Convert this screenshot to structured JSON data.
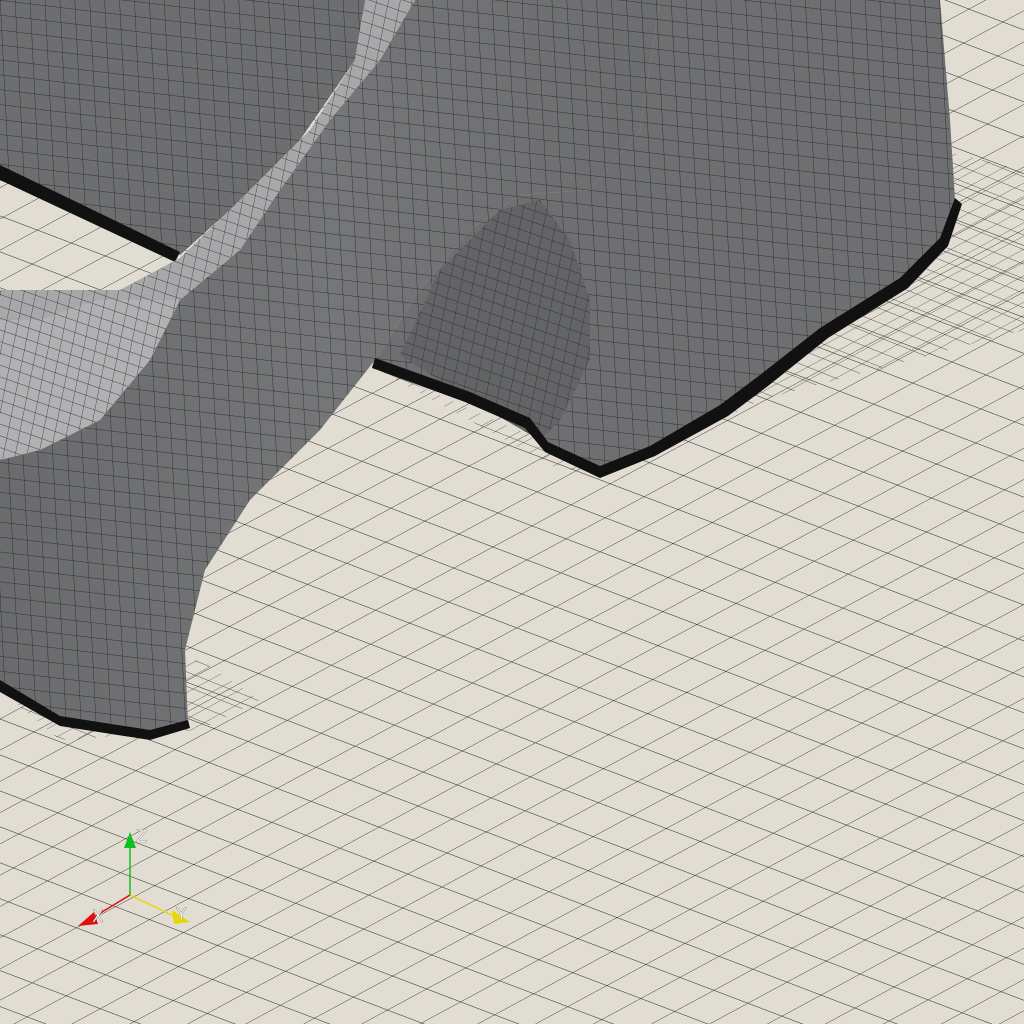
{
  "viewer": {
    "colors": {
      "background": "#e2ddd2",
      "mesh_line": "#1a1a1a",
      "solid_face": "#6f7072",
      "solid_face_light": "#a3a4a6",
      "solid_face_dark": "#585a5c",
      "edge_band": "#111111"
    }
  },
  "orientation_axes": {
    "x": {
      "label": "X",
      "color": "#e01010"
    },
    "y": {
      "label": "Y",
      "color": "#e8d800"
    },
    "z": {
      "label": "Z",
      "color": "#10c020"
    }
  }
}
